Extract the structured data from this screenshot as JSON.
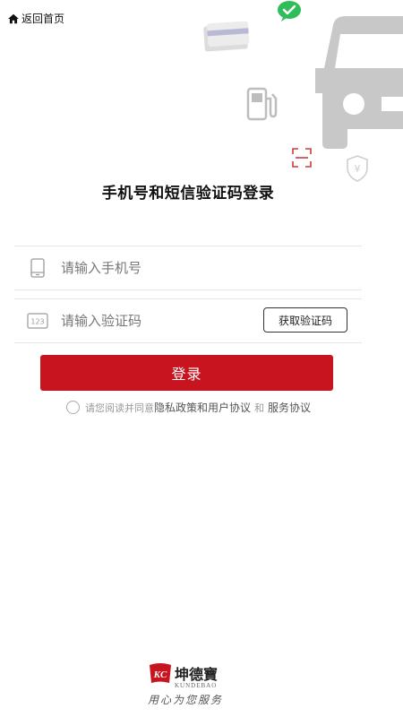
{
  "header": {
    "back_label": "返回首页"
  },
  "title": "手机号和短信验证码登录",
  "phone_field": {
    "placeholder": "请输入手机号",
    "value": ""
  },
  "code_field": {
    "placeholder": "请输入验证码",
    "value": "",
    "icon_text": "123"
  },
  "get_code_button": "获取验证码",
  "login_button": "登录",
  "agreement": {
    "prefix": "请您阅读并同意",
    "privacy_link": "隐私政策和用户协议",
    "conjunction": "和",
    "service_link": "服务协议"
  },
  "brand": {
    "name": "坤德寶",
    "pinyin": "KUNDEBAO",
    "slogan": "用心为您服务",
    "logo_letters": "KC"
  },
  "colors": {
    "accent": "#c8141f",
    "wechat": "#2ebd59",
    "deco_gray": "#c8c8c8"
  },
  "icons": [
    "home-icon",
    "wechat-icon",
    "card-icon",
    "fuel-pump-icon",
    "car-icon",
    "scan-icon",
    "yuan-shield-icon",
    "phone-icon",
    "code-icon"
  ]
}
